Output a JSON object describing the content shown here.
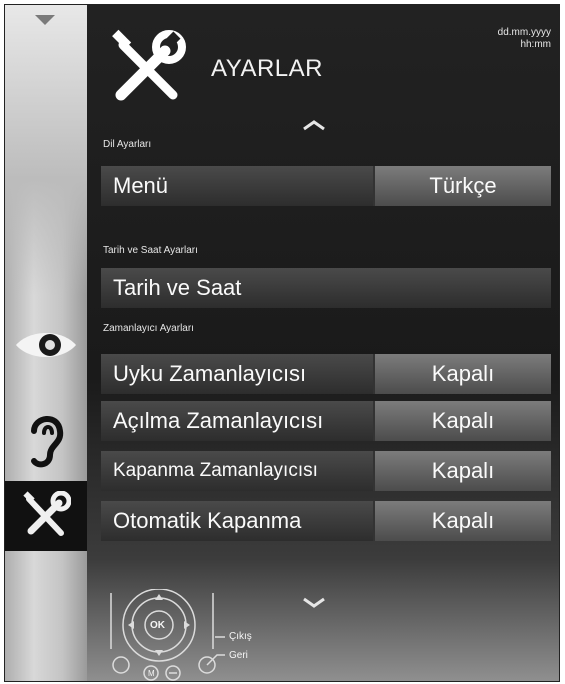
{
  "header": {
    "title": "AYARLAR",
    "date_format": "dd.mm.yyyy",
    "time_format": "hh:mm"
  },
  "sidebar": {
    "items": [
      {
        "icon": "eye-icon",
        "active": false
      },
      {
        "icon": "ear-icon",
        "active": false
      },
      {
        "icon": "tools-icon",
        "active": true
      }
    ]
  },
  "sections": {
    "language": {
      "title": "Dil Ayarları",
      "menu": {
        "label": "Menü",
        "value": "Türkçe"
      }
    },
    "datetime": {
      "title": "Tarih ve Saat Ayarları",
      "item": {
        "label": "Tarih ve Saat"
      }
    },
    "timers": {
      "title": "Zamanlayıcı Ayarları",
      "items": [
        {
          "label": "Uyku Zamanlayıcısı",
          "value": "Kapalı"
        },
        {
          "label": "Açılma Zamanlayıcısı",
          "value": "Kapalı"
        },
        {
          "label": "Kapanma Zamanlayıcısı",
          "value": "Kapalı"
        },
        {
          "label": "Otomatik Kapanma",
          "value": "Kapalı"
        }
      ]
    }
  },
  "legend": {
    "ok": "OK",
    "m": "M",
    "exit": "Çıkış",
    "back": "Geri"
  },
  "colors": {
    "background": "#161616",
    "row_label": "#3a3a3a",
    "row_value": "#6a6a6a",
    "text": "#fafafa"
  }
}
